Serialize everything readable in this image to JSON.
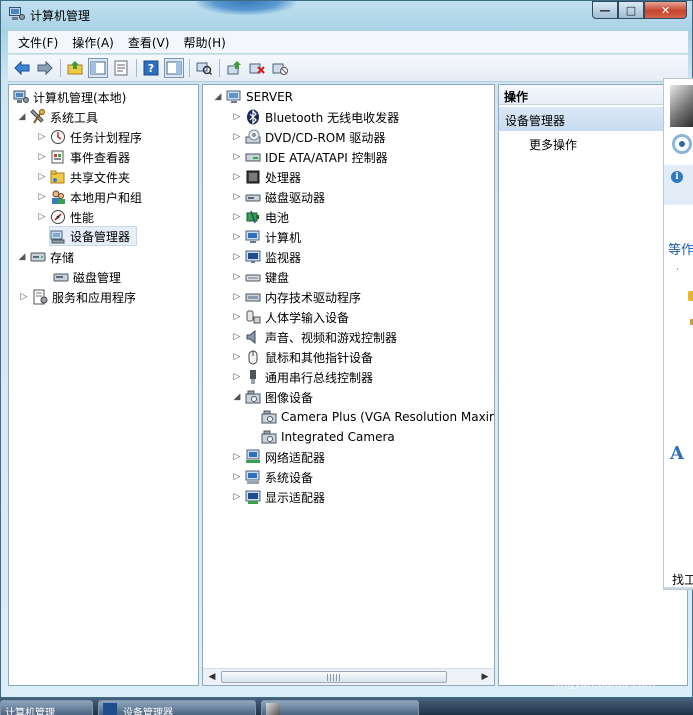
{
  "window": {
    "title": "计算机管理",
    "buttons": {
      "minimize": "—",
      "maximize": "□",
      "close": "✕"
    }
  },
  "menu": [
    "文件(F)",
    "操作(A)",
    "查看(V)",
    "帮助(H)"
  ],
  "toolbar": [
    "back-arrow-icon",
    "forward-arrow-icon",
    "up-folder-icon",
    "show-hide-console-tree-icon",
    "properties-icon",
    "help-icon",
    "show-hide-action-pane-icon",
    "scan-hardware-icon",
    "update-driver-icon",
    "uninstall-icon",
    "disable-icon"
  ],
  "left_tree": {
    "root": "计算机管理(本地)",
    "system_tools": "系统工具",
    "task_scheduler": "任务计划程序",
    "event_viewer": "事件查看器",
    "shared_folders": "共享文件夹",
    "local_users": "本地用户和组",
    "performance": "性能",
    "device_manager": "设备管理器",
    "storage": "存储",
    "disk_management": "磁盘管理",
    "services": "服务和应用程序"
  },
  "device_tree": {
    "root": "SERVER",
    "categories": [
      "Bluetooth 无线电收发器",
      "DVD/CD-ROM 驱动器",
      "IDE ATA/ATAPI 控制器",
      "处理器",
      "磁盘驱动器",
      "电池",
      "计算机",
      "监视器",
      "键盘",
      "内存技术驱动程序",
      "人体学输入设备",
      "声音、视频和游戏控制器",
      "鼠标和其他指针设备",
      "通用串行总线控制器",
      "图像设备",
      "网络适配器",
      "系统设备",
      "显示适配器"
    ],
    "imaging_children": [
      "Camera Plus (VGA Resolution Maxir",
      "Integrated Camera"
    ]
  },
  "actions": {
    "header": "操作",
    "section": "设备管理器",
    "more": "更多操作"
  },
  "overlay": {
    "text1": "等作",
    "bullet1": "·",
    "font_glyph": "A",
    "text2": "找工"
  },
  "taskbar": [
    "计算机管理",
    "设备管理器",
    ""
  ],
  "watermark": {
    "main": "Bai 经验",
    "sub": "jingyan.baidu.com"
  }
}
